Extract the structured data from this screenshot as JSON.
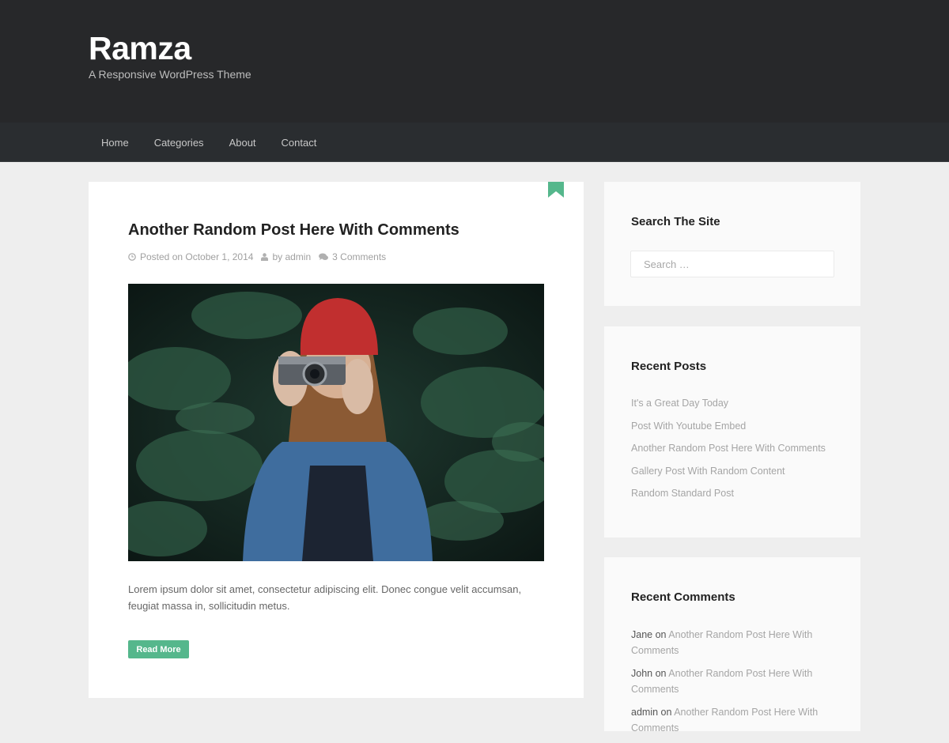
{
  "header": {
    "site_title": "Ramza",
    "tagline": "A Responsive WordPress Theme"
  },
  "nav": {
    "items": [
      {
        "label": "Home"
      },
      {
        "label": "Categories"
      },
      {
        "label": "About"
      },
      {
        "label": "Contact"
      }
    ]
  },
  "post": {
    "title": "Another Random Post Here With Comments",
    "meta": {
      "date": "Posted on October 1, 2014",
      "author": "by admin",
      "comments": "3 Comments"
    },
    "image_alt": "Woman in red beanie holding a camera among pine branches",
    "excerpt": "Lorem ipsum dolor sit amet, consectetur adipiscing elit. Donec congue velit accumsan, feugiat massa in, sollicitudin metus.",
    "read_more_label": "Read More",
    "bookmark_icon": "bookmark-icon"
  },
  "sidebar": {
    "search": {
      "title": "Search The Site",
      "placeholder": "Search …",
      "value": ""
    },
    "recent_posts": {
      "title": "Recent Posts",
      "items": [
        {
          "label": "It's a Great Day Today"
        },
        {
          "label": "Post With Youtube Embed"
        },
        {
          "label": "Another Random Post Here With Comments"
        },
        {
          "label": "Gallery Post With Random Content"
        },
        {
          "label": "Random Standard Post"
        }
      ]
    },
    "recent_comments": {
      "title": "Recent Comments",
      "items": [
        {
          "author": "Jane",
          "on": " on ",
          "post": "Another Random Post Here With Comments"
        },
        {
          "author": "John",
          "on": " on ",
          "post": "Another Random Post Here With Comments"
        },
        {
          "author": "admin",
          "on": " on ",
          "post": "Another Random Post Here With Comments"
        }
      ]
    }
  },
  "colors": {
    "accent": "#55b78c",
    "header_bg": "#27282a",
    "nav_bg": "#2a2d30",
    "page_bg": "#eeeeee"
  }
}
